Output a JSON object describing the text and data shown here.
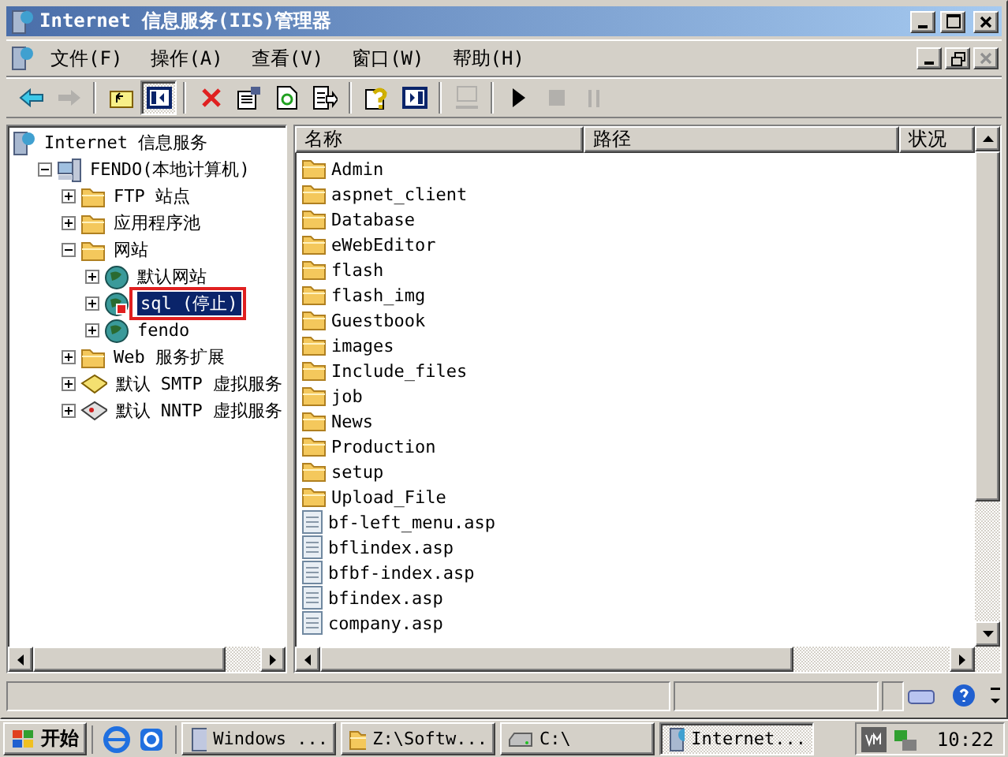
{
  "window": {
    "title": "Internet 信息服务(IIS)管理器"
  },
  "menu": [
    {
      "label": "文件(F)"
    },
    {
      "label": "操作(A)"
    },
    {
      "label": "查看(V)"
    },
    {
      "label": "窗口(W)"
    },
    {
      "label": "帮助(H)"
    }
  ],
  "toolbar": [
    {
      "kind": "back",
      "disabled": false
    },
    {
      "kind": "forward",
      "disabled": true
    },
    {
      "kind": "separator"
    },
    {
      "kind": "up",
      "disabled": false
    },
    {
      "kind": "tree",
      "disabled": false,
      "pressed": true
    },
    {
      "kind": "separator"
    },
    {
      "kind": "delete",
      "disabled": false
    },
    {
      "kind": "properties",
      "disabled": false
    },
    {
      "kind": "refresh",
      "disabled": false
    },
    {
      "kind": "export",
      "disabled": false
    },
    {
      "kind": "separator"
    },
    {
      "kind": "help",
      "disabled": false
    },
    {
      "kind": "pane",
      "disabled": false
    },
    {
      "kind": "separator"
    },
    {
      "kind": "computer",
      "disabled": true
    },
    {
      "kind": "separator"
    },
    {
      "kind": "play",
      "disabled": false
    },
    {
      "kind": "stop",
      "disabled": true
    },
    {
      "kind": "pause",
      "disabled": true
    }
  ],
  "tree": [
    {
      "label": "Internet 信息服务",
      "kind": "services",
      "selected": false,
      "children": [
        {
          "label": "FENDO(本地计算机)",
          "kind": "computer",
          "expanded": true,
          "selected": false,
          "children": [
            {
              "label": "FTP 站点",
              "kind": "folder",
              "expanded": false,
              "selected": false
            },
            {
              "label": "应用程序池",
              "kind": "folder",
              "expanded": false,
              "selected": false
            },
            {
              "label": "网站",
              "kind": "folder",
              "expanded": true,
              "selected": false,
              "children": [
                {
                  "label": "默认网站",
                  "kind": "site",
                  "expanded": false,
                  "stopped": false,
                  "selected": false
                },
                {
                  "label": "sql (停止)",
                  "kind": "site",
                  "expanded": false,
                  "stopped": true,
                  "selected": true,
                  "marked": true
                },
                {
                  "label": "fendo",
                  "kind": "site",
                  "expanded": false,
                  "stopped": false,
                  "selected": false
                }
              ]
            },
            {
              "label": "Web 服务扩展",
              "kind": "folder",
              "expanded": false,
              "selected": false
            },
            {
              "label": "默认 SMTP 虚拟服务",
              "kind": "smtp",
              "expanded": false,
              "selected": false
            },
            {
              "label": "默认 NNTP 虚拟服务",
              "kind": "nntp",
              "expanded": false,
              "selected": false
            }
          ]
        }
      ]
    }
  ],
  "list": {
    "columns": [
      "名称",
      "路径",
      "状况"
    ],
    "rows": [
      {
        "kind": "folder",
        "name": "Admin"
      },
      {
        "kind": "folder",
        "name": "aspnet_client"
      },
      {
        "kind": "folder",
        "name": "Database"
      },
      {
        "kind": "folder",
        "name": "eWebEditor"
      },
      {
        "kind": "folder",
        "name": "flash"
      },
      {
        "kind": "folder",
        "name": "flash_img"
      },
      {
        "kind": "folder",
        "name": "Guestbook"
      },
      {
        "kind": "folder",
        "name": "images"
      },
      {
        "kind": "folder",
        "name": "Include_files"
      },
      {
        "kind": "folder",
        "name": "job"
      },
      {
        "kind": "folder",
        "name": "News"
      },
      {
        "kind": "folder",
        "name": "Production"
      },
      {
        "kind": "folder",
        "name": "setup"
      },
      {
        "kind": "folder",
        "name": "Upload_File"
      },
      {
        "kind": "file",
        "name": "bf-left_menu.asp"
      },
      {
        "kind": "file",
        "name": "bflindex.asp"
      },
      {
        "kind": "file",
        "name": "bfbf-index.asp"
      },
      {
        "kind": "file",
        "name": "bfindex.asp"
      },
      {
        "kind": "file",
        "name": "company.asp"
      }
    ]
  },
  "taskbar": {
    "start": "开始",
    "tasks": [
      {
        "label": "Windows ...",
        "kind": "window",
        "selected": false
      },
      {
        "label": "Z:\\Softw...",
        "kind": "folder",
        "selected": false
      },
      {
        "label": "C:\\",
        "kind": "drive",
        "selected": false
      },
      {
        "label": "Internet...",
        "kind": "services",
        "selected": true
      }
    ],
    "clock": "10:22"
  }
}
